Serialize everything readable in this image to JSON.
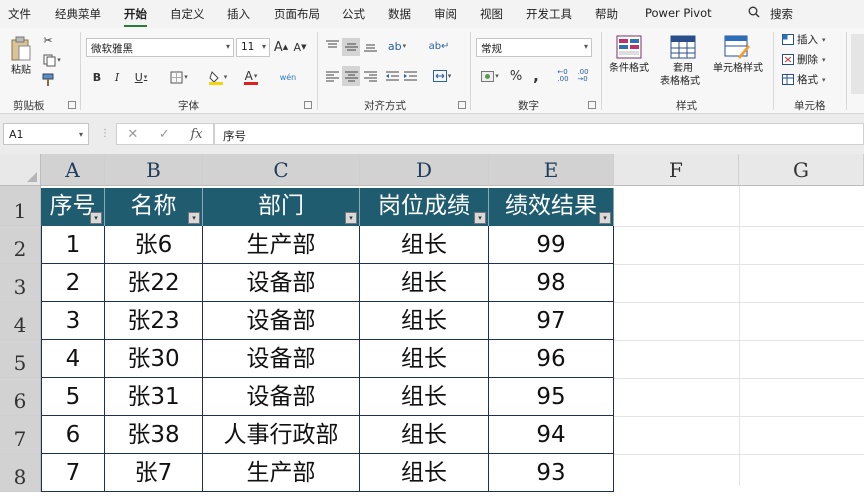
{
  "menu_tabs": [
    "文件",
    "经典菜单",
    "开始",
    "自定义",
    "插入",
    "页面布局",
    "公式",
    "数据",
    "审阅",
    "视图",
    "开发工具",
    "帮助",
    "Power Pivot"
  ],
  "active_tab": "开始",
  "search_label": "搜索",
  "ribbon": {
    "clipboard": {
      "label": "剪贴板",
      "paste": "粘贴"
    },
    "font": {
      "label": "字体",
      "font_name": "微软雅黑",
      "font_size": "11",
      "bold": "B",
      "italic": "I",
      "underline": "U",
      "font_color": "A",
      "grow": "A",
      "shrink": "A",
      "phonetic": "wén"
    },
    "alignment": {
      "label": "对齐方式"
    },
    "number": {
      "label": "数字",
      "format": "常规",
      "percent": "%",
      "comma": ","
    },
    "styles": {
      "label": "样式",
      "conditional": "条件格式",
      "table_format_1": "套用",
      "table_format_2": "表格格式",
      "cell_styles": "单元格样式"
    },
    "cells": {
      "label": "单元格",
      "insert": "插入",
      "delete": "删除",
      "format": "格式"
    }
  },
  "formula_bar": {
    "name_box": "A1",
    "cancel": "✕",
    "enter": "✓",
    "fx": "fx",
    "content": "序号"
  },
  "columns": [
    "A",
    "B",
    "C",
    "D",
    "E",
    "F",
    "G"
  ],
  "rows": [
    "1",
    "2",
    "3",
    "4",
    "5",
    "6",
    "7",
    "8"
  ],
  "table": {
    "headers": [
      "序号",
      "名称",
      "部门",
      "岗位成绩",
      "绩效结果"
    ],
    "rows": [
      [
        "1",
        "张6",
        "生产部",
        "组长",
        "99"
      ],
      [
        "2",
        "张22",
        "设备部",
        "组长",
        "98"
      ],
      [
        "3",
        "张23",
        "设备部",
        "组长",
        "97"
      ],
      [
        "4",
        "张30",
        "设备部",
        "组长",
        "96"
      ],
      [
        "5",
        "张31",
        "设备部",
        "组长",
        "95"
      ],
      [
        "6",
        "张38",
        "人事行政部",
        "组长",
        "94"
      ],
      [
        "7",
        "张7",
        "生产部",
        "组长",
        "93"
      ]
    ]
  },
  "colors": {
    "header_fill": "#1f5c70",
    "border": "#1f2f55",
    "accent": "#2a7a3c"
  }
}
